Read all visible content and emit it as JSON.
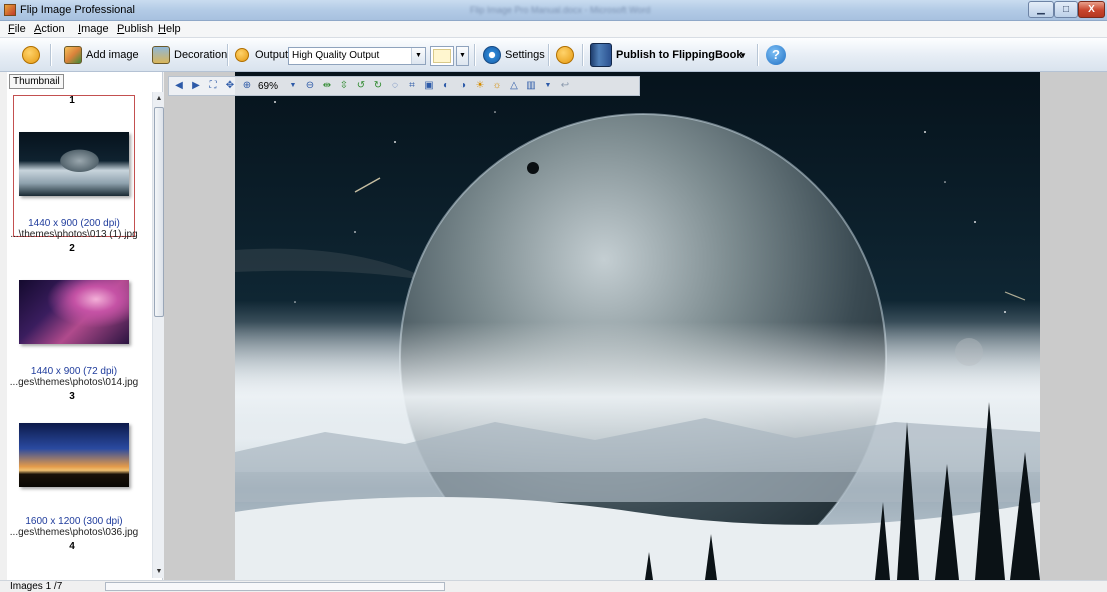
{
  "window": {
    "title": "Flip Image Professional",
    "center_caption": "Flip Image Pro Manual.docx - Microsoft Word",
    "min_glyph": "▁",
    "max_glyph": "□",
    "close_glyph": "X"
  },
  "menu": [
    {
      "key": "F",
      "rest": "ile"
    },
    {
      "key": "A",
      "rest": "ction"
    },
    {
      "key": "I",
      "rest": "mage"
    },
    {
      "key": "P",
      "rest": "ublish"
    },
    {
      "key": "H",
      "rest": "elp"
    }
  ],
  "toolbar": {
    "add_image": "Add image",
    "decoration": "Decoration",
    "output_label": "Output:",
    "output_value": "High Quality Output",
    "settings": "Settings",
    "publish": "Publish to FlippingBook",
    "dropdown_arrow": "▼",
    "help_glyph": "?"
  },
  "thumbnail_panel": {
    "tab_label": "Thumbnail",
    "items": [
      {
        "number": "1",
        "size": "",
        "path": ""
      },
      {
        "number": "2",
        "size": "1440 x 900 (200 dpi)",
        "path": "...\\themes\\photos\\013 (1).jpg"
      },
      {
        "number": "3",
        "size": "1440 x 900 (72 dpi)",
        "path": "...ges\\themes\\photos\\014.jpg"
      },
      {
        "number": "4",
        "size": "1600 x 1200 (300 dpi)",
        "path": "...ges\\themes\\photos\\036.jpg"
      }
    ]
  },
  "viewer": {
    "zoom": "69%"
  },
  "status": {
    "text": "Images 1 /7"
  },
  "colors": {
    "accent": "#2d5aa8",
    "selected_border": "#c35050",
    "color_swatch": "#fff6cf"
  }
}
